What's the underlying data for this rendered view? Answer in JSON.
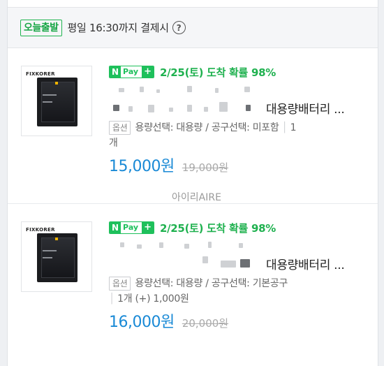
{
  "notice": {
    "badge": "오늘출발",
    "text": "평일 16:30까지 결제시",
    "help_icon": "?"
  },
  "items": [
    {
      "thumb_brand": "FIXKORER",
      "npay": {
        "n": "N",
        "pay": "Pay",
        "plus": "+"
      },
      "shipping": "2/25(토) 도착 확률 98%",
      "title_visible": "대용량배터리 ...",
      "option_tag": "옵션",
      "option_text": "용량선택: 대용량 / 공구선택: 미포함",
      "qty": "1",
      "qty_line2": "개",
      "price": "15,000원",
      "original_price": "19,000원",
      "seller": "아이리AIRE"
    },
    {
      "thumb_brand": "FIXKORER",
      "npay": {
        "n": "N",
        "pay": "Pay",
        "plus": "+"
      },
      "shipping": "2/25(토) 도착 확률 98%",
      "title_visible": "대용량배터리 ...",
      "option_tag": "옵션",
      "option_text": "용량선택: 대용량 / 공구선택: 기본공구",
      "qty_line2": "1개 (+) 1,000원",
      "price": "16,000원",
      "original_price": "20,000원"
    }
  ]
}
